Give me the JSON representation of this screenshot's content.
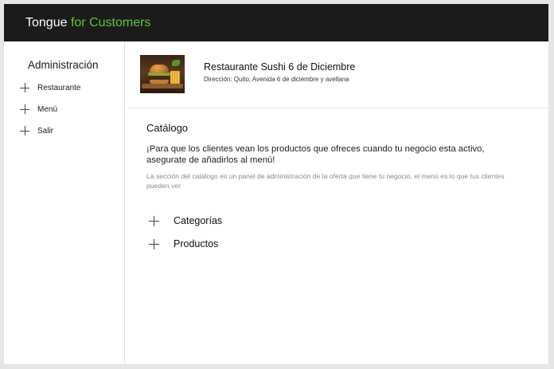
{
  "brand": {
    "name": "Tongue",
    "suffix": "for Customers",
    "accent_color": "#5fc93a"
  },
  "sidebar": {
    "title": "Administración",
    "items": [
      {
        "label": "Restaurante",
        "icon": "plus-icon"
      },
      {
        "label": "Menú",
        "icon": "plus-icon"
      },
      {
        "label": "Salir",
        "icon": "plus-icon"
      }
    ]
  },
  "restaurant": {
    "image": "burger-photo",
    "name": "Restaurante Sushi 6 de Diciembre",
    "address": "Dirección: Quito, Avenida 6 de diciembre y avellana"
  },
  "catalog": {
    "title": "Catálogo",
    "lead": "¡Para que los clientes vean los productos que ofreces cuando tu negocio esta activo, asegurate de añadirlos al menú!",
    "note": "La sección del catálogo es un panel de administración de la oferta que tiene tu negocio, el menú es lo que tus clientes pueden ver",
    "items": [
      {
        "label": "Categorías",
        "icon": "plus-icon"
      },
      {
        "label": "Productos",
        "icon": "plus-icon"
      }
    ]
  },
  "colors": {
    "topbar": "#1b1b1b",
    "background": "#ffffff"
  }
}
